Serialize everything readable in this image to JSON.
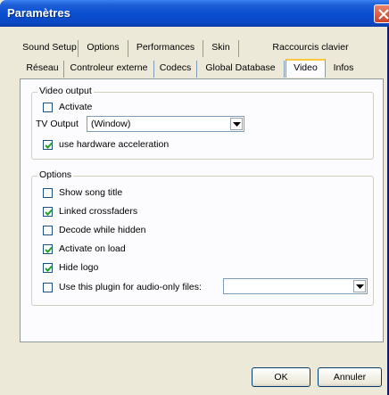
{
  "window": {
    "title": "Paramètres"
  },
  "tabs_row1": [
    "Sound Setup",
    "Options",
    "Performances",
    "Skin",
    "Raccourcis clavier"
  ],
  "tabs_row2": [
    "Réseau",
    "Controleur externe",
    "Codecs",
    "Global Database",
    "Video",
    "Infos"
  ],
  "selected_tab": "Video",
  "video_output": {
    "legend": "Video output",
    "activate": {
      "label": "Activate",
      "checked": false
    },
    "tv_output": {
      "label": "TV Output",
      "value": "(Window)"
    },
    "hw_accel": {
      "label": "use hardware acceleration",
      "checked": true
    }
  },
  "options": {
    "legend": "Options",
    "items": [
      {
        "label": "Show song title",
        "checked": false
      },
      {
        "label": "Linked crossfaders",
        "checked": true
      },
      {
        "label": "Decode while hidden",
        "checked": false
      },
      {
        "label": "Activate on load",
        "checked": true
      },
      {
        "label": "Hide logo",
        "checked": true
      },
      {
        "label": "Use this plugin for audio-only files:",
        "checked": false
      }
    ],
    "audio_plugin_value": ""
  },
  "buttons": {
    "ok": "OK",
    "cancel": "Annuler"
  }
}
